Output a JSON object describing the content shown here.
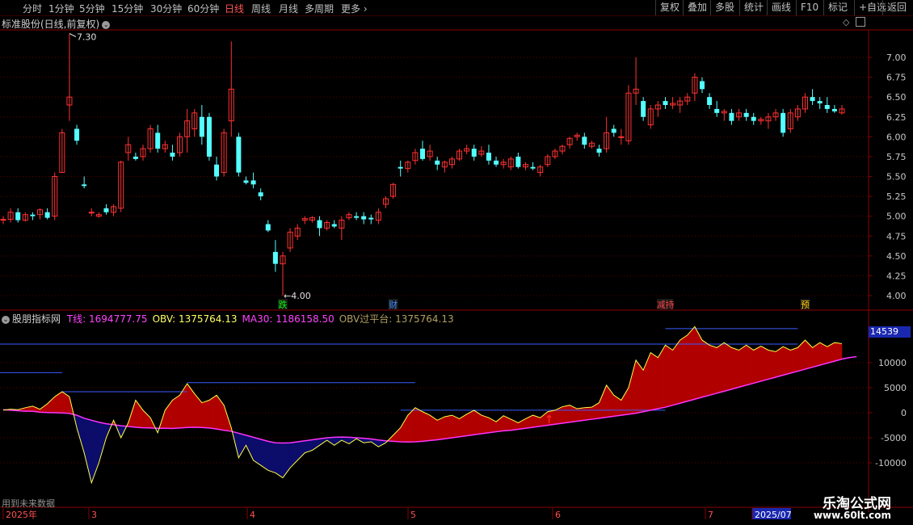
{
  "toolbar": {
    "periods": [
      "分时",
      "1分钟",
      "5分钟",
      "15分钟",
      "30分钟",
      "60分钟",
      "日线",
      "周线",
      "月线",
      "多周期",
      "更多"
    ],
    "active_period": "日线",
    "right_buttons": [
      "复权",
      "叠加",
      "多股",
      "统计",
      "画线",
      "F10",
      "标记",
      "+自选",
      "返回"
    ]
  },
  "price_panel": {
    "title": "标准股份(日线,前复权)",
    "high_label": "7.30",
    "low_label": "4.00",
    "axis_ticks": [
      "7.00",
      "6.75",
      "6.50",
      "6.25",
      "6.00",
      "5.75",
      "5.50",
      "5.25",
      "5.00",
      "4.75",
      "4.50",
      "4.25",
      "4.00"
    ],
    "markers": [
      {
        "text": "跌",
        "color": "#00ff00"
      },
      {
        "text": "财",
        "color": "#3a8cff"
      },
      {
        "text": "减持",
        "color": "#ff4040"
      },
      {
        "text": "预",
        "color": "#ffcc00"
      }
    ]
  },
  "indicator_panel": {
    "name": "股朋指标网",
    "items": [
      {
        "label": "T线:",
        "value": "1694777.75",
        "color": "#ff44ff"
      },
      {
        "label": "OBV:",
        "value": "1375764.13",
        "color": "#ffff66"
      },
      {
        "label": "MA30:",
        "value": "1186158.50",
        "color": "#ff44ff"
      },
      {
        "label": "OBV过平台:",
        "value": "1375764.13",
        "color": "#b0a060"
      }
    ],
    "axis_ticks": [
      "10000",
      "5000",
      "0",
      "-5000",
      "-10000"
    ],
    "current_value": "14539",
    "note": "用到未来数据"
  },
  "date_axis": {
    "labels": [
      "2025年",
      "3",
      "4",
      "5",
      "6",
      "7",
      "2025/07"
    ]
  },
  "watermark": {
    "name": "乐淘公式网",
    "url": "www.60lt.com"
  },
  "colors": {
    "up": "#ff3232",
    "down": "#54ffff",
    "grid": "#8a0000",
    "obv_line": "#ffff44",
    "ma_line": "#ff33ff",
    "fill_up": "#b00000",
    "fill_down": "#0c0c6a",
    "platform": "#3a5cff"
  },
  "chart_data": [
    {
      "type": "candlestick",
      "price_axis": [
        4.0,
        7.0
      ],
      "candles": [
        [
          4.95,
          5.0,
          4.9,
          4.96
        ],
        [
          4.96,
          5.1,
          4.92,
          5.05
        ],
        [
          5.05,
          5.1,
          4.92,
          4.95
        ],
        [
          4.95,
          5.05,
          4.93,
          5.02
        ],
        [
          5.02,
          5.05,
          4.95,
          5.0
        ],
        [
          5.02,
          5.1,
          4.96,
          5.08
        ],
        [
          5.05,
          5.1,
          4.96,
          4.98
        ],
        [
          5.0,
          5.55,
          4.95,
          5.5
        ],
        [
          5.55,
          6.1,
          5.55,
          6.05
        ],
        [
          6.4,
          7.3,
          6.2,
          6.5
        ],
        [
          6.1,
          6.15,
          5.9,
          5.95
        ],
        [
          5.4,
          5.5,
          5.35,
          5.38
        ],
        [
          5.05,
          5.1,
          5.0,
          5.05
        ],
        [
          5.0,
          5.05,
          4.98,
          5.02
        ],
        [
          5.1,
          5.15,
          5.02,
          5.05
        ],
        [
          5.05,
          5.15,
          5.0,
          5.12
        ],
        [
          5.1,
          5.7,
          5.05,
          5.68
        ],
        [
          5.8,
          6.0,
          5.7,
          5.9
        ],
        [
          5.75,
          5.8,
          5.7,
          5.72
        ],
        [
          5.75,
          5.9,
          5.7,
          5.85
        ],
        [
          5.85,
          6.15,
          5.8,
          6.1
        ],
        [
          6.05,
          6.15,
          5.8,
          5.85
        ],
        [
          5.85,
          5.95,
          5.8,
          5.9
        ],
        [
          5.8,
          5.9,
          5.7,
          5.75
        ],
        [
          5.8,
          6.05,
          5.75,
          6.0
        ],
        [
          6.0,
          6.35,
          5.8,
          6.2
        ],
        [
          6.1,
          6.35,
          6.0,
          6.3
        ],
        [
          6.25,
          6.4,
          5.9,
          6.0
        ],
        [
          6.25,
          6.3,
          5.7,
          5.75
        ],
        [
          5.65,
          5.75,
          5.45,
          5.5
        ],
        [
          5.55,
          6.1,
          5.5,
          6.05
        ],
        [
          6.2,
          7.2,
          6.0,
          6.6
        ],
        [
          6.0,
          6.05,
          5.5,
          5.55
        ],
        [
          5.45,
          5.5,
          5.4,
          5.42
        ],
        [
          5.45,
          5.55,
          5.35,
          5.4
        ],
        [
          5.3,
          5.35,
          5.2,
          5.25
        ],
        [
          4.9,
          4.95,
          4.8,
          4.82
        ],
        [
          4.55,
          4.7,
          4.3,
          4.4
        ],
        [
          4.4,
          4.55,
          4.0,
          4.5
        ],
        [
          4.6,
          4.85,
          4.55,
          4.8
        ],
        [
          4.75,
          4.9,
          4.7,
          4.85
        ],
        [
          4.95,
          5.0,
          4.9,
          4.97
        ],
        [
          4.95,
          5.0,
          4.92,
          4.98
        ],
        [
          4.95,
          5.0,
          4.75,
          4.85
        ],
        [
          4.85,
          4.95,
          4.82,
          4.92
        ],
        [
          4.9,
          4.95,
          4.85,
          4.87
        ],
        [
          4.85,
          5.0,
          4.7,
          4.95
        ],
        [
          4.98,
          5.05,
          4.95,
          5.02
        ],
        [
          5.0,
          5.05,
          4.95,
          4.98
        ],
        [
          5.0,
          5.05,
          4.9,
          4.96
        ],
        [
          4.98,
          5.02,
          4.9,
          4.96
        ],
        [
          4.95,
          5.1,
          4.9,
          5.05
        ],
        [
          5.15,
          5.25,
          5.1,
          5.22
        ],
        [
          5.25,
          5.42,
          5.22,
          5.4
        ],
        [
          5.62,
          5.7,
          5.5,
          5.6
        ],
        [
          5.6,
          5.7,
          5.55,
          5.68
        ],
        [
          5.7,
          5.85,
          5.65,
          5.8
        ],
        [
          5.85,
          5.95,
          5.7,
          5.72
        ],
        [
          5.75,
          5.9,
          5.7,
          5.82
        ],
        [
          5.7,
          5.75,
          5.58,
          5.65
        ],
        [
          5.62,
          5.7,
          5.55,
          5.68
        ],
        [
          5.65,
          5.75,
          5.6,
          5.72
        ],
        [
          5.72,
          5.85,
          5.7,
          5.82
        ],
        [
          5.82,
          5.9,
          5.78,
          5.85
        ],
        [
          5.85,
          5.9,
          5.7,
          5.75
        ],
        [
          5.78,
          5.88,
          5.75,
          5.82
        ],
        [
          5.8,
          5.9,
          5.65,
          5.7
        ],
        [
          5.7,
          5.75,
          5.62,
          5.65
        ],
        [
          5.65,
          5.72,
          5.6,
          5.68
        ],
        [
          5.62,
          5.75,
          5.58,
          5.72
        ],
        [
          5.75,
          5.8,
          5.6,
          5.62
        ],
        [
          5.62,
          5.68,
          5.58,
          5.65
        ],
        [
          5.62,
          5.68,
          5.58,
          5.6
        ],
        [
          5.55,
          5.65,
          5.5,
          5.62
        ],
        [
          5.65,
          5.78,
          5.62,
          5.75
        ],
        [
          5.75,
          5.85,
          5.72,
          5.82
        ],
        [
          5.82,
          5.9,
          5.78,
          5.88
        ],
        [
          5.9,
          6.0,
          5.85,
          5.98
        ],
        [
          6.0,
          6.05,
          5.95,
          6.02
        ],
        [
          6.0,
          6.05,
          5.85,
          5.9
        ],
        [
          5.88,
          5.95,
          5.85,
          5.92
        ],
        [
          5.85,
          5.9,
          5.75,
          5.8
        ],
        [
          5.85,
          6.25,
          5.8,
          6.05
        ],
        [
          6.1,
          6.15,
          6.0,
          6.05
        ],
        [
          6.0,
          6.1,
          5.9,
          6.0
        ],
        [
          5.95,
          6.65,
          5.9,
          6.55
        ],
        [
          6.55,
          7.0,
          6.4,
          6.6
        ],
        [
          6.45,
          6.5,
          6.2,
          6.25
        ],
        [
          6.15,
          6.4,
          6.1,
          6.35
        ],
        [
          6.35,
          6.45,
          6.25,
          6.4
        ],
        [
          6.45,
          6.5,
          6.35,
          6.4
        ],
        [
          6.4,
          6.5,
          6.35,
          6.42
        ],
        [
          6.4,
          6.5,
          6.3,
          6.45
        ],
        [
          6.45,
          6.55,
          6.4,
          6.5
        ],
        [
          6.55,
          6.8,
          6.45,
          6.75
        ],
        [
          6.7,
          6.75,
          6.55,
          6.6
        ],
        [
          6.5,
          6.55,
          6.35,
          6.4
        ],
        [
          6.35,
          6.45,
          6.25,
          6.3
        ],
        [
          6.3,
          6.35,
          6.2,
          6.32
        ],
        [
          6.3,
          6.35,
          6.15,
          6.2
        ],
        [
          6.25,
          6.35,
          6.2,
          6.3
        ],
        [
          6.3,
          6.35,
          6.2,
          6.25
        ],
        [
          6.25,
          6.3,
          6.15,
          6.2
        ],
        [
          6.2,
          6.25,
          6.15,
          6.22
        ],
        [
          6.2,
          6.3,
          6.1,
          6.25
        ],
        [
          6.25,
          6.35,
          6.2,
          6.3
        ],
        [
          6.3,
          6.35,
          6.0,
          6.05
        ],
        [
          6.1,
          6.35,
          6.05,
          6.3
        ],
        [
          6.25,
          6.4,
          6.2,
          6.35
        ],
        [
          6.35,
          6.55,
          6.3,
          6.5
        ],
        [
          6.5,
          6.6,
          6.4,
          6.45
        ],
        [
          6.45,
          6.5,
          6.35,
          6.42
        ],
        [
          6.4,
          6.5,
          6.3,
          6.35
        ],
        [
          6.35,
          6.4,
          6.3,
          6.32
        ],
        [
          6.3,
          6.4,
          6.28,
          6.35
        ]
      ],
      "marker_positions": [
        38,
        53,
        90,
        109
      ]
    },
    {
      "type": "area",
      "value_axis": [
        -10000,
        10000
      ],
      "obv": [
        500,
        700,
        600,
        1000,
        1300,
        700,
        1800,
        3200,
        4200,
        3200,
        -3000,
        -8000,
        -14000,
        -10000,
        -5000,
        -1500,
        -5000,
        -2000,
        2500,
        500,
        -1000,
        -4000,
        500,
        2500,
        3500,
        5800,
        3800,
        2000,
        2500,
        3500,
        1500,
        -3000,
        -9000,
        -6500,
        -9500,
        -10500,
        -11500,
        -12000,
        -13000,
        -11000,
        -9500,
        -8000,
        -7500,
        -6500,
        -5500,
        -6500,
        -5500,
        -6200,
        -5200,
        -6000,
        -5800,
        -6800,
        -6000,
        -4500,
        -3000,
        -500,
        1000,
        200,
        -500,
        -1500,
        -800,
        -500,
        -1200,
        -300,
        500,
        -500,
        -1000,
        -1800,
        -600,
        -1300,
        -2000,
        -1200,
        -500,
        -1000,
        200,
        500,
        1200,
        1500,
        800,
        1000,
        1100,
        2000,
        5500,
        3500,
        2500,
        5000,
        10500,
        8500,
        12000,
        11000,
        13500,
        12500,
        14500,
        15500,
        17200,
        14500,
        13500,
        13000,
        14000,
        13000,
        12500,
        13500,
        12500,
        13300,
        12500,
        12200,
        13200,
        12500,
        13000,
        14500,
        13000,
        14000,
        13200,
        14000,
        13800
      ],
      "ma30": [
        600,
        500,
        400,
        300,
        300,
        100,
        50,
        0,
        -50,
        -150,
        -500,
        -1100,
        -1500,
        -1900,
        -2200,
        -2400,
        -2600,
        -2750,
        -2900,
        -3000,
        -3050,
        -3100,
        -3100,
        -3150,
        -3050,
        -2950,
        -2900,
        -2950,
        -3050,
        -3250,
        -3500,
        -3700,
        -4100,
        -4500,
        -4900,
        -5300,
        -5700,
        -6000,
        -6050,
        -6000,
        -5800,
        -5600,
        -5400,
        -5200,
        -5000,
        -4900,
        -4850,
        -4900,
        -5000,
        -5100,
        -5250,
        -5450,
        -5600,
        -5700,
        -5800,
        -5850,
        -5800,
        -5700,
        -5550,
        -5400,
        -5200,
        -5000,
        -4800,
        -4600,
        -4400,
        -4200,
        -4000,
        -3800,
        -3600,
        -3500,
        -3300,
        -3100,
        -2900,
        -2700,
        -2500,
        -2300,
        -2100,
        -1900,
        -1700,
        -1500,
        -1300,
        -1100,
        -900,
        -700,
        -500,
        -300,
        -100,
        200,
        500,
        800,
        1100,
        1500,
        1900,
        2300,
        2700,
        3100,
        3500,
        3900,
        4300,
        4700,
        5100,
        5500,
        5900,
        6300,
        6700,
        7100,
        7500,
        7900,
        8300,
        8700,
        9100,
        9500,
        9900,
        10300,
        10700,
        11000,
        11200
      ],
      "platforms": [
        {
          "from": 0,
          "to": 8,
          "value": 8000
        },
        {
          "from": 8,
          "to": 25,
          "value": 4200
        },
        {
          "from": 25,
          "to": 56,
          "value": 6000
        },
        {
          "from": 54,
          "to": 90,
          "value": 500
        },
        {
          "from": 90,
          "to": 108,
          "value": 16800
        },
        {
          "from": 0,
          "to": 108,
          "value": 13700
        }
      ]
    }
  ]
}
